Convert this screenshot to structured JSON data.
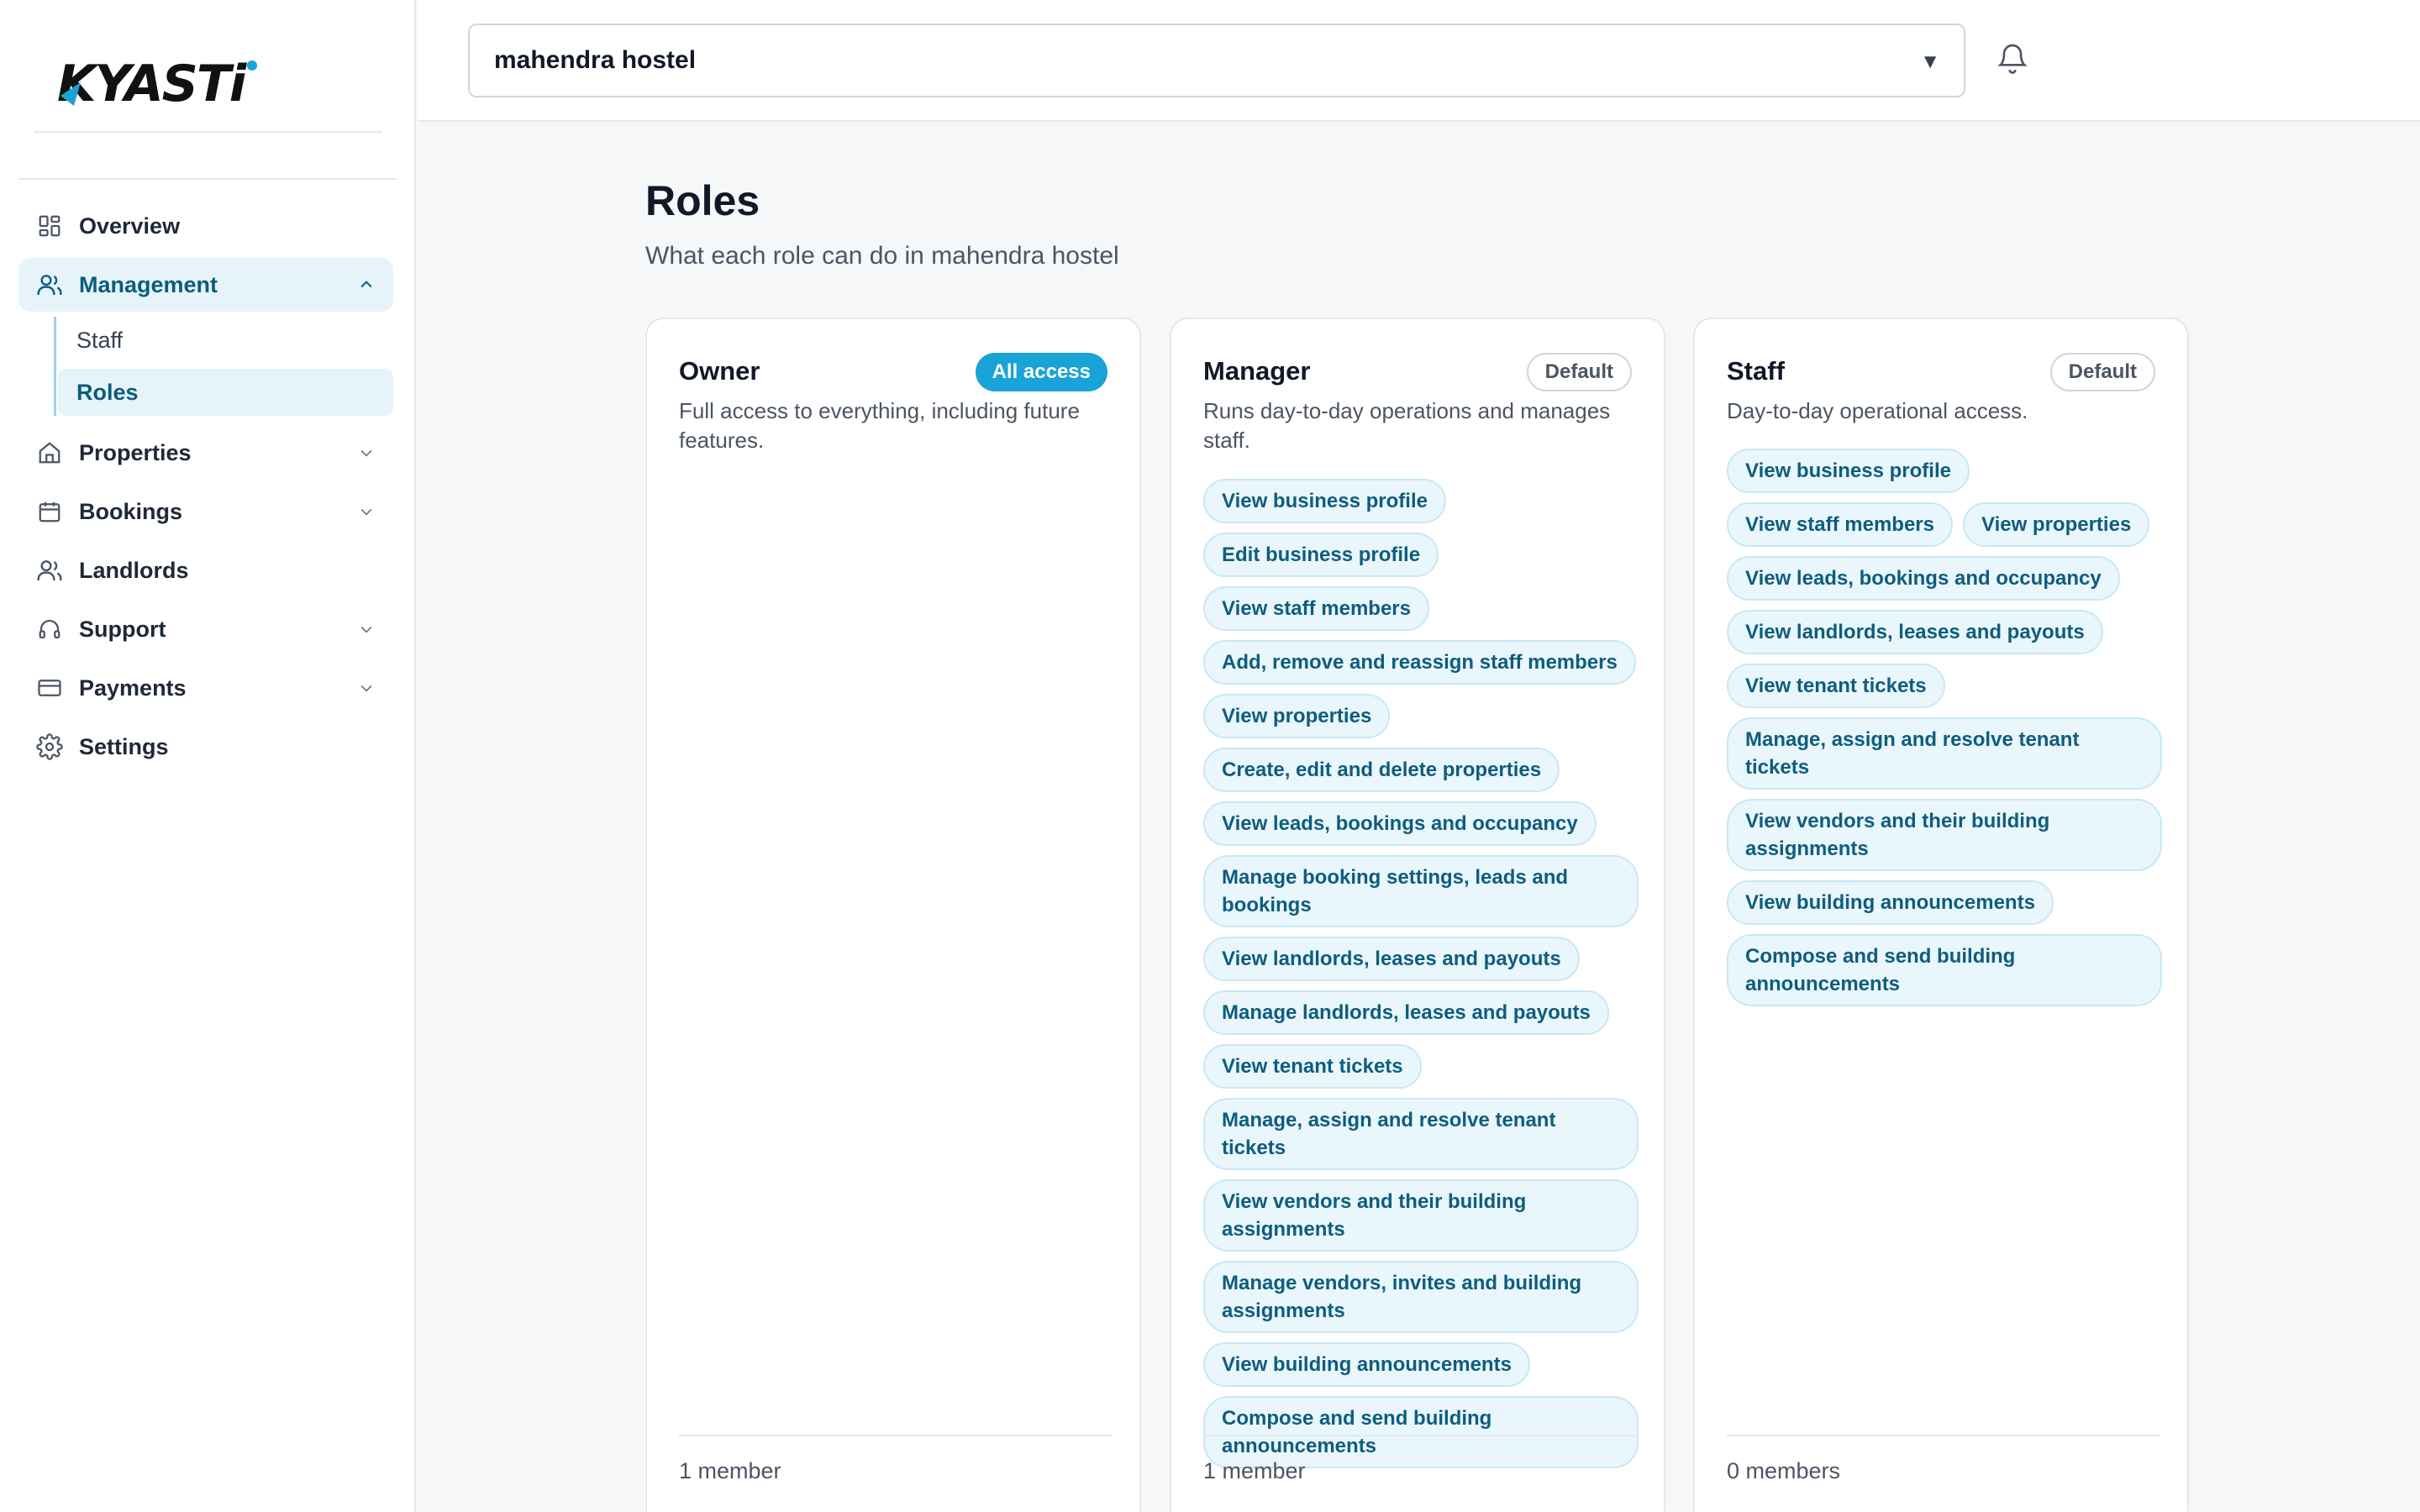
{
  "brand": {
    "logo_text": "KYASTi"
  },
  "sidebar": {
    "items": [
      {
        "label": "Overview",
        "icon": "grid-icon"
      },
      {
        "label": "Management",
        "icon": "users-icon",
        "expanded": true,
        "children": [
          {
            "label": "Staff"
          },
          {
            "label": "Roles",
            "active": true
          }
        ]
      },
      {
        "label": "Properties",
        "icon": "home-icon"
      },
      {
        "label": "Bookings",
        "icon": "calendar-icon"
      },
      {
        "label": "Landlords",
        "icon": "users-icon"
      },
      {
        "label": "Support",
        "icon": "headset-icon"
      },
      {
        "label": "Payments",
        "icon": "credit-card-icon"
      },
      {
        "label": "Settings",
        "icon": "gear-icon"
      }
    ]
  },
  "header": {
    "property_select": {
      "value": "mahendra hostel"
    }
  },
  "main": {
    "title": "Roles",
    "subtitle": "What each role can do in mahendra hostel",
    "roles": [
      {
        "name": "Owner",
        "badge": "All access",
        "description": "Full access to everything, including future features.",
        "permissions": [],
        "footer": "1 member"
      },
      {
        "name": "Manager",
        "badge": "Default",
        "description": "Runs day-to-day operations and manages staff.",
        "permissions": [
          "View business profile",
          "Edit business profile",
          "View staff members",
          "Add, remove and reassign staff members",
          "View properties",
          "Create, edit and delete properties",
          "View leads, bookings and occupancy",
          "Manage booking settings, leads and bookings",
          "View landlords, leases and payouts",
          "Manage landlords, leases and payouts",
          "View tenant tickets",
          "Manage, assign and resolve tenant tickets",
          "View vendors and their building assignments",
          "Manage vendors, invites and building assignments",
          "View building announcements",
          "Compose and send building announcements"
        ],
        "footer": "1 member"
      },
      {
        "name": "Staff",
        "badge": "Default",
        "description": "Day-to-day operational access.",
        "permissions": [
          "View business profile",
          "View staff members",
          "View properties",
          "View leads, bookings and occupancy",
          "View landlords, leases and payouts",
          "View tenant tickets",
          "Manage, assign and resolve tenant tickets",
          "View vendors and their building assignments",
          "View building announcements",
          "Compose and send building announcements"
        ],
        "footer": "0 members"
      }
    ]
  },
  "colors": {
    "accent": "#1aa3d6",
    "active_bg": "#e6f4fa",
    "chip_text": "#0e5d7d"
  }
}
